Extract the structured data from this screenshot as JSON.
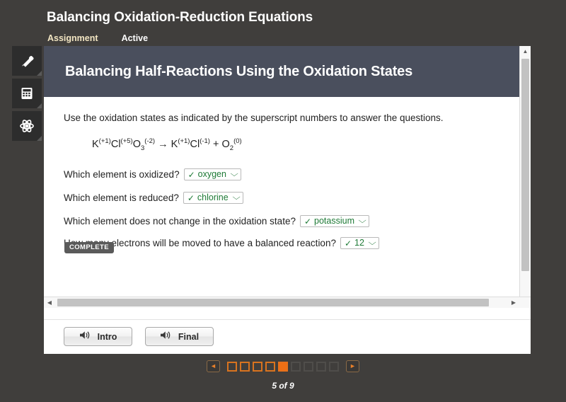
{
  "header": {
    "title": "Balancing Oxidation-Reduction Equations",
    "breadcrumb_assignment": "Assignment",
    "breadcrumb_status": "Active"
  },
  "sidebar": {
    "tools": [
      {
        "name": "highlighter-icon",
        "label": "Highlighter"
      },
      {
        "name": "calculator-icon",
        "label": "Calculator"
      },
      {
        "name": "atom-icon",
        "label": "Periodic Table"
      }
    ]
  },
  "lesson": {
    "banner_title": "Balancing Half-Reactions Using the Oxidation States",
    "instructions": "Use the oxidation states as indicated by the superscript numbers to answer the questions.",
    "equation": {
      "left": [
        {
          "symbol": "K",
          "sup": "(+1)",
          "sub": ""
        },
        {
          "symbol": "Cl",
          "sup": "(+5)",
          "sub": ""
        },
        {
          "symbol": "O",
          "sup": "(-2)",
          "sub": "3"
        }
      ],
      "arrow": "→",
      "right_a": [
        {
          "symbol": "K",
          "sup": "(+1)",
          "sub": ""
        },
        {
          "symbol": "Cl",
          "sup": "(-1)",
          "sub": ""
        }
      ],
      "plus": "+",
      "right_b": [
        {
          "symbol": "O",
          "sup": "(0)",
          "sub": "2"
        }
      ]
    },
    "questions": [
      {
        "text": "Which element is oxidized?",
        "answer": "oxygen",
        "correct": true
      },
      {
        "text": "Which element is reduced?",
        "answer": "chlorine",
        "correct": true
      },
      {
        "text": "Which element does not change in the oxidation state?",
        "answer": "potassium",
        "correct": true
      },
      {
        "text": "How many electrons will be moved to have a balanced reaction?",
        "answer": "12",
        "correct": true
      }
    ],
    "status_badge": "COMPLETE",
    "check_glyph": "✓",
    "caret_glyph": "⌵"
  },
  "footer": {
    "buttons": [
      {
        "label": "Intro",
        "icon": "speaker-icon"
      },
      {
        "label": "Final",
        "icon": "speaker-icon"
      }
    ]
  },
  "pager": {
    "prev_glyph": "◄",
    "next_glyph": "►",
    "total_pages": 9,
    "current_page": 5,
    "count_label": "5 of 9",
    "states": [
      "visited",
      "visited",
      "visited",
      "visited",
      "current",
      "upcoming",
      "upcoming",
      "upcoming",
      "upcoming"
    ]
  },
  "scrollbars": {
    "up_glyph": "▲",
    "down_glyph": "▼",
    "left_glyph": "◀",
    "right_glyph": "▶"
  },
  "colors": {
    "page_background": "#403e3c",
    "banner": "#4a4f5d",
    "accent_orange": "#ee6f15",
    "answer_green": "#1e7a36",
    "breadcrumb_cream": "#f2e5c2"
  }
}
